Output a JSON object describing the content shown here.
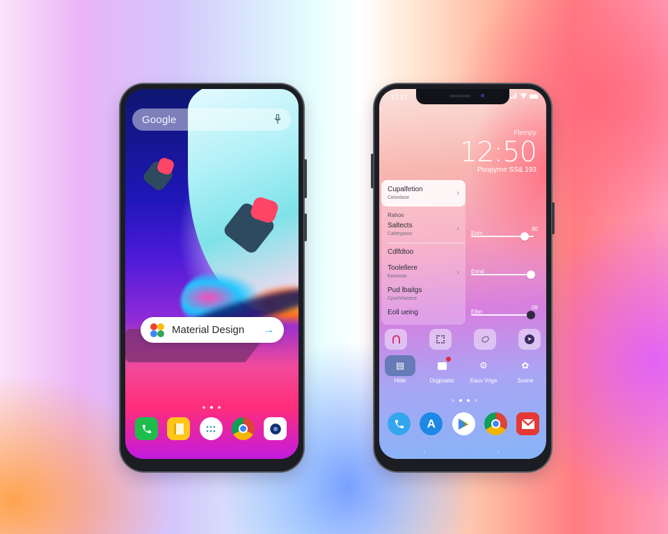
{
  "scene": {
    "description": "Two Android phone mockups on a pastel gradient background"
  },
  "left_phone": {
    "search_bar": {
      "label": "Google",
      "icon": "mic-icon"
    },
    "card": {
      "label": "Material Design",
      "logo": "material-logo-icon",
      "action_icon": "arrow-right-icon"
    },
    "page_indicator": {
      "count": 3,
      "active_index": 1
    },
    "dock": [
      {
        "name": "phone",
        "icon": "phone-icon",
        "color": "#1ebc4b"
      },
      {
        "name": "notes",
        "icon": "notes-icon",
        "color": "#ffc61a"
      },
      {
        "name": "app-drawer",
        "icon": "grid-icon",
        "color": "#ffffff"
      },
      {
        "name": "chrome",
        "icon": "chrome-icon",
        "color": "#db4437"
      },
      {
        "name": "camera",
        "icon": "camera-icon",
        "color": "#ffffff"
      }
    ]
  },
  "right_phone": {
    "status_bar": {
      "time": "12:47",
      "icons": [
        "signal-icon",
        "wifi-icon",
        "battery-icon"
      ]
    },
    "lock": {
      "label": "Flempy",
      "time": "12:50",
      "date": "Poopyrne SS& 193"
    },
    "quick_settings": [
      {
        "title": "Cupalfetion",
        "subtitle": "Ceionlase",
        "chevron": true,
        "selected": true
      },
      {
        "section": "Rahos",
        "title": "Saltects",
        "subtitle": "Caittrypoos",
        "chevron": true
      },
      {
        "title": "Cdlfdtoo",
        "chevron": false
      },
      {
        "title": "Toolellere",
        "subtitle": "Eeonose",
        "chevron": true
      },
      {
        "title": "Pud lbaitgs",
        "subtitle": "CpuriVrasece",
        "chevron": false
      },
      {
        "title": "Eoll ueing",
        "chevron": false
      }
    ],
    "sliders": [
      {
        "label": "Enm",
        "value_label": "80",
        "value": 0.85,
        "thumb": "light"
      },
      {
        "label": "Ennd",
        "value_label": "",
        "value": 0.96,
        "thumb": "light"
      },
      {
        "label": "Elbn",
        "value_label": "09",
        "value": 0.96,
        "thumb": "dark"
      }
    ],
    "tiles": [
      {
        "name": "tile-1",
        "icon": "arch-icon"
      },
      {
        "name": "tile-2",
        "icon": "qr-icon"
      },
      {
        "name": "tile-3",
        "icon": "leaf-icon"
      },
      {
        "name": "tile-4",
        "icon": "compass-icon"
      }
    ],
    "shortcuts": [
      {
        "label": "Hide",
        "icon": "image-icon",
        "active": true,
        "badge": false
      },
      {
        "label": "Orgpnatio",
        "icon": "message-icon",
        "active": false,
        "badge": true
      },
      {
        "label": "Eaus Vrige",
        "icon": "gear-icon",
        "active": false,
        "badge": false
      },
      {
        "label": "Soone",
        "icon": "settings-icon",
        "active": false,
        "badge": false
      }
    ],
    "page_indicator": {
      "count": 4,
      "active_index": 1
    },
    "dock": [
      {
        "name": "phone",
        "icon": "phone-icon",
        "color": "#33a6ef"
      },
      {
        "name": "app-store",
        "icon": "app-store-icon",
        "color": "#1e88e5"
      },
      {
        "name": "play-store",
        "icon": "play-store-icon",
        "color": "#ffffff"
      },
      {
        "name": "chrome",
        "icon": "chrome-icon",
        "color": "#db4437"
      },
      {
        "name": "gmail",
        "icon": "gmail-icon",
        "color": "#e53935"
      }
    ]
  }
}
